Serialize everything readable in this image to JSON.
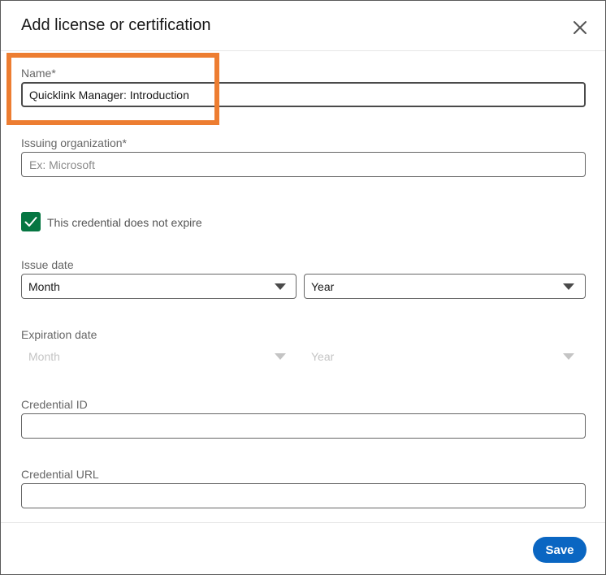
{
  "dialog": {
    "title": "Add license or certification",
    "close_icon": "close-icon"
  },
  "fields": {
    "name": {
      "label": "Name*",
      "value": "Quicklink Manager: Introduction",
      "placeholder": ""
    },
    "issuing_org": {
      "label": "Issuing organization*",
      "value": "",
      "placeholder": "Ex: Microsoft"
    },
    "no_expire": {
      "label": "This credential does not expire",
      "checked": true,
      "icon": "checkmark-icon"
    },
    "issue_date": {
      "label": "Issue date",
      "month": "Month",
      "year": "Year"
    },
    "expiration_date": {
      "label": "Expiration date",
      "month": "Month",
      "year": "Year",
      "disabled": true
    },
    "credential_id": {
      "label": "Credential ID",
      "value": ""
    },
    "credential_url": {
      "label": "Credential URL",
      "value": ""
    }
  },
  "footer": {
    "save_label": "Save"
  },
  "colors": {
    "accent": "#0a66c2",
    "checkbox_green": "#057642",
    "highlight": "#ed7d31"
  }
}
